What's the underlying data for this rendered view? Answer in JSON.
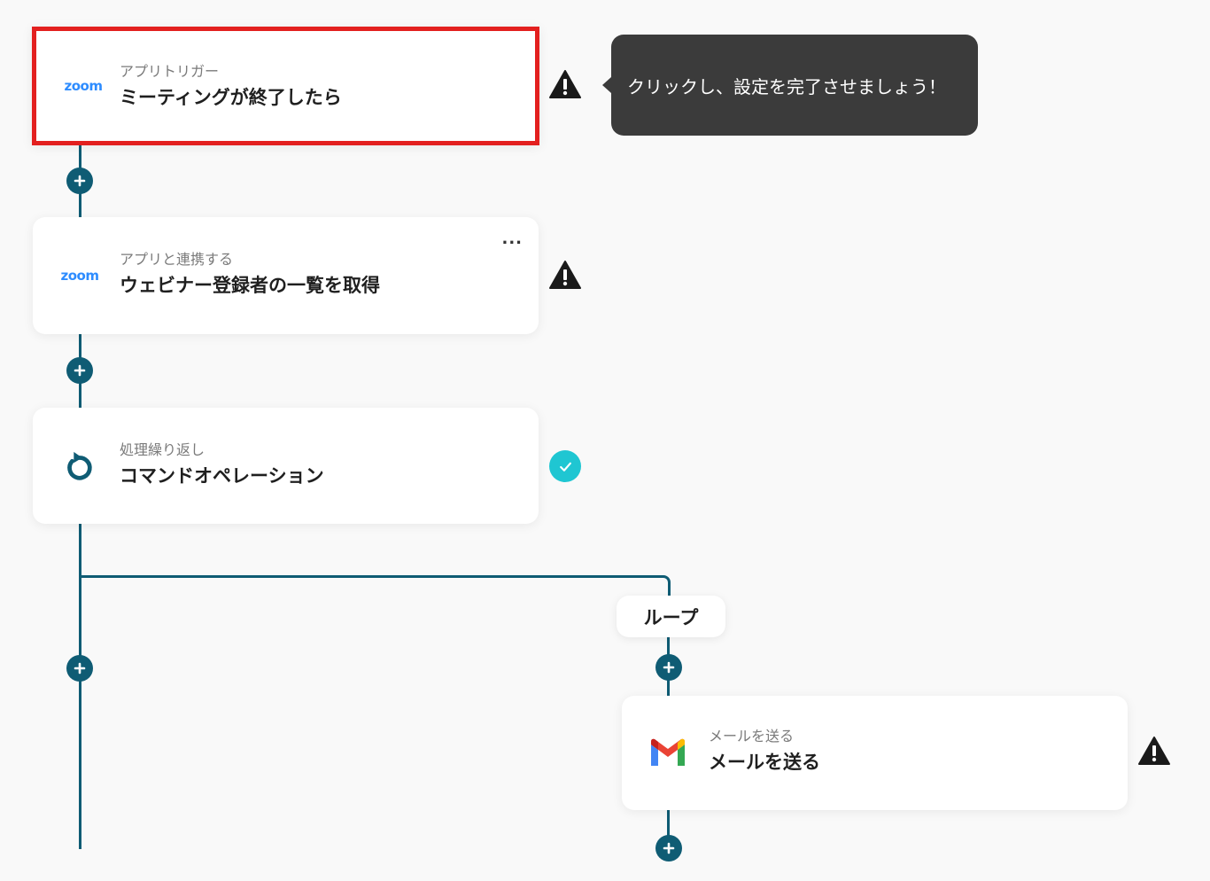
{
  "tooltip": {
    "text": "クリックし、設定を完了させましょう！"
  },
  "steps": [
    {
      "sub": "アプリトリガー",
      "title": "ミーティングが終了したら",
      "logo": "zoom",
      "status": "warning-icon",
      "selected": true
    },
    {
      "sub": "アプリと連携する",
      "title": "ウェビナー登録者の一覧を取得",
      "logo": "zoom",
      "status": "warning-icon",
      "menu": "..."
    },
    {
      "sub": "処理繰り返し",
      "title": "コマンドオペレーション",
      "logo": "loop-arrow-icon",
      "status": "check-icon"
    },
    {
      "sub": "メールを送る",
      "title": "メールを送る",
      "logo": "gmail-icon",
      "status": "warning-icon"
    }
  ],
  "loop": {
    "label": "ループ"
  },
  "logo_text": {
    "zoom": "zoom"
  },
  "colors": {
    "line": "#0f5c74",
    "selected_border": "#e3201f",
    "tooltip_bg": "#3b3b3b",
    "ok": "#1fc6d2",
    "zoom": "#2d8cff"
  }
}
